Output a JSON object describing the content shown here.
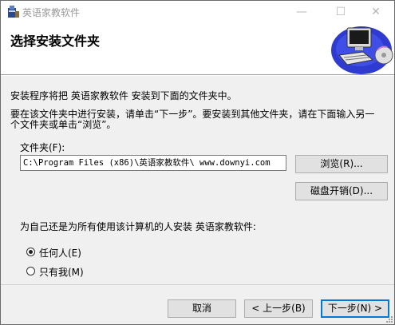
{
  "window": {
    "title": "英语家教软件",
    "minimize_glyph": "—",
    "maximize_glyph": "☐",
    "close_glyph": "✕"
  },
  "header": {
    "title": "选择安装文件夹",
    "art_icon": "computer-cd-icon"
  },
  "body": {
    "line1": "安装程序将把 英语家教软件 安装到下面的文件夹中。",
    "line2a": "要在该文件夹中进行安装，请单击“下一步”。要安装到其他文件夹，请在下面输入另一",
    "line2b": "个文件夹或单击“浏览”。",
    "folder_label": "文件夹(F):",
    "folder_value": "C:\\Program Files (x86)\\英语家教软件\\ www.downyi.com",
    "browse_button": "浏览(R)...",
    "disk_cost_button": "磁盘开销(D)...",
    "for_whom_label": "为自己还是为所有使用该计算机的人安装 英语家教软件:",
    "radio_everyone": "任何人(E)",
    "radio_just_me": "只有我(M)",
    "selected": "everyone"
  },
  "footer": {
    "cancel": "取消",
    "back": "< 上一步(B)",
    "next": "下一步(N) >"
  },
  "colors": {
    "accent": "#0078d7",
    "header_bg": "#ffffff",
    "dialog_bg": "#f0f0f0"
  }
}
